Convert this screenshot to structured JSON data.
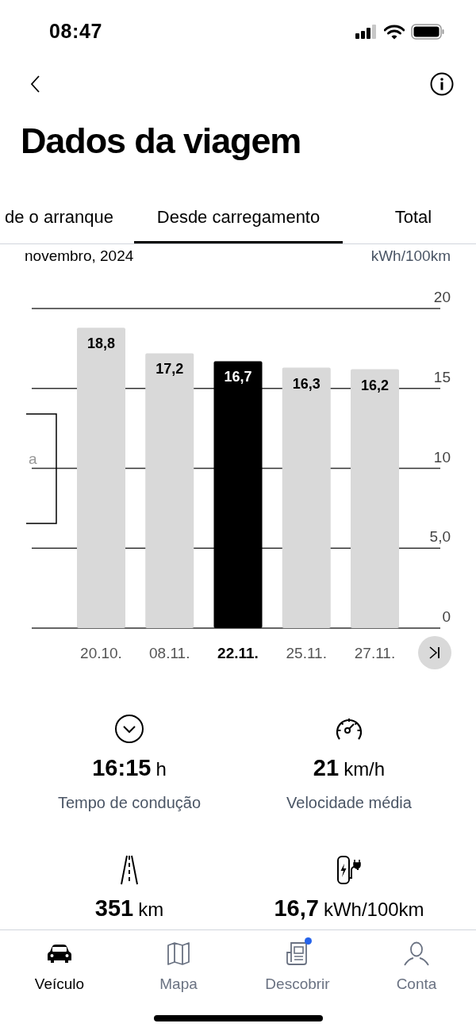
{
  "status_bar": {
    "time": "08:47"
  },
  "header": {
    "title": "Dados da viagem"
  },
  "tabs": [
    {
      "label": "de o arranque",
      "selected": false
    },
    {
      "label": "Desde carregamento",
      "selected": true
    },
    {
      "label": "Total",
      "selected": false
    }
  ],
  "chart": {
    "period": "novembro, 2024",
    "unit": "kWh/100km",
    "overlay_text": "a",
    "selected": [
      false,
      false,
      true,
      false,
      false
    ],
    "chart_data": {
      "type": "bar",
      "categories": [
        "20.10.",
        "08.11.",
        "22.11.",
        "25.11.",
        "27.11."
      ],
      "values": [
        18.8,
        17.2,
        16.7,
        16.3,
        16.2
      ],
      "value_labels": [
        "18,8",
        "17,2",
        "16,7",
        "16,3",
        "16,2"
      ],
      "ylim": [
        0,
        20
      ],
      "grid": true,
      "yticks": [
        0,
        {
          "value": 5,
          "label": "5,0"
        },
        10,
        15,
        20
      ]
    }
  },
  "stats": [
    {
      "value": "16:15",
      "unit": "h",
      "label": "Tempo de condução"
    },
    {
      "value": "21",
      "unit": "km/h",
      "label": "Velocidade média"
    },
    {
      "value": "351",
      "unit": "km"
    },
    {
      "value": "16,7",
      "unit": "kWh/100km"
    }
  ],
  "bottom_nav": [
    {
      "label": "Veículo",
      "selected": true,
      "badge": false
    },
    {
      "label": "Mapa",
      "selected": false,
      "badge": false
    },
    {
      "label": "Descobrir",
      "selected": false,
      "badge": true
    },
    {
      "label": "Conta",
      "selected": false,
      "badge": false
    }
  ]
}
